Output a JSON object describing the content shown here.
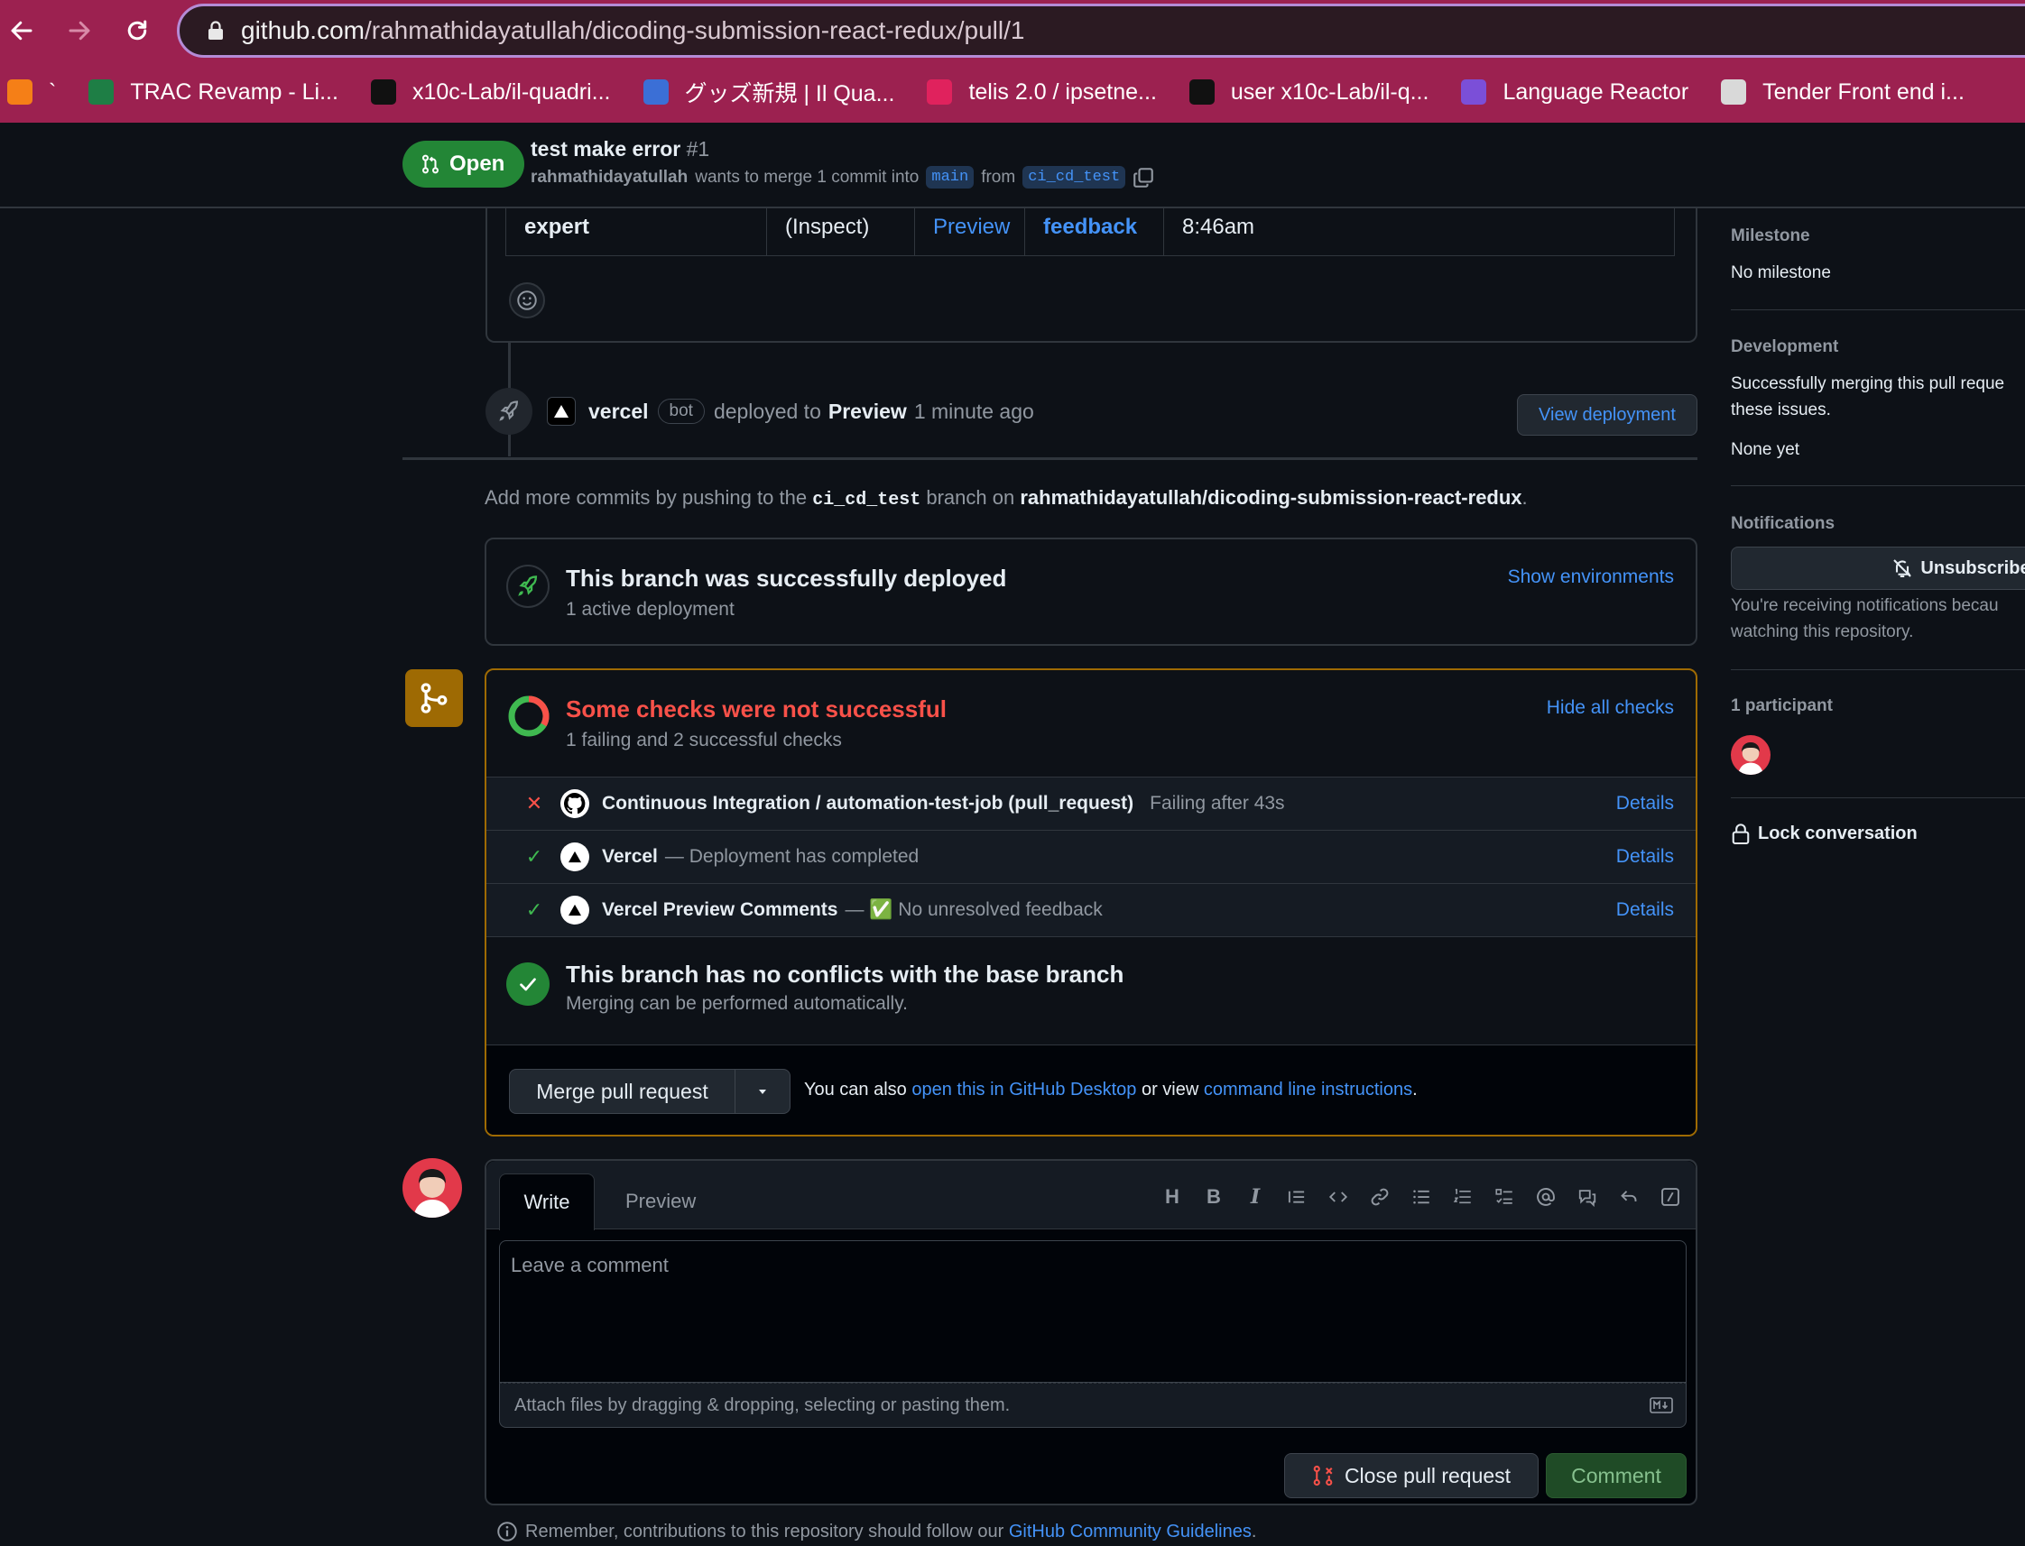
{
  "browser": {
    "url_host": "github.com",
    "url_path": "/rahmathidayatullah/dicoding-submission-react-redux/pull/1",
    "bookmarks": [
      {
        "label": "`",
        "color": "#f57f17",
        "icon": "xampp-icon"
      },
      {
        "label": "TRAC Revamp - Li...",
        "color": "#1e7e45",
        "icon": "excel-icon"
      },
      {
        "label": "x10c-Lab/il-quadri...",
        "color": "#111111",
        "icon": "github-icon"
      },
      {
        "label": "グッズ新規 | Il Qua...",
        "color": "#3b6fd6",
        "icon": "shield-icon"
      },
      {
        "label": "telis 2.0 / ipsetne...",
        "color": "#e0225d",
        "icon": "chevron-icon"
      },
      {
        "label": "user x10c-Lab/il-q...",
        "color": "#111111",
        "icon": "github-icon"
      },
      {
        "label": "Language Reactor",
        "color": "#7b4fd8",
        "icon": "lr-icon"
      },
      {
        "label": "Tender Front end i...",
        "color": "#d9d9d9",
        "icon": "trello-icon"
      }
    ]
  },
  "pr": {
    "state": "Open",
    "title": "test make error",
    "number": "#1",
    "author": "rahmathidayatullah",
    "merge_text": "wants to merge 1 commit into",
    "base": "main",
    "from_text": "from",
    "head": "ci_cd_test"
  },
  "deploy_table": {
    "cells": [
      "expert",
      "(Inspect)",
      "Preview",
      "feedback",
      "8:46am"
    ]
  },
  "deploy_event": {
    "actor": "vercel",
    "bot_label": "bot",
    "action": "deployed to",
    "target": "Preview",
    "time": "1 minute ago",
    "button": "View deployment"
  },
  "push_hint": {
    "prefix": "Add more commits by pushing to the",
    "branch": "ci_cd_test",
    "middle": "branch on",
    "repo": "rahmathidayatullah/dicoding-submission-react-redux",
    "suffix": "."
  },
  "deployments": {
    "title": "This branch was successfully deployed",
    "subtitle": "1 active deployment",
    "link": "Show environments"
  },
  "checks": {
    "title": "Some checks were not successful",
    "subtitle": "1 failing and 2 successful checks",
    "toggle": "Hide all checks",
    "items": [
      {
        "status": "fail",
        "name": "Continuous Integration / automation-test-job (pull_request)",
        "desc": "Failing after 43s",
        "link": "Details"
      },
      {
        "status": "success",
        "name": "Vercel",
        "desc": "— Deployment has completed",
        "link": "Details"
      },
      {
        "status": "success",
        "name": "Vercel Preview Comments",
        "desc": "— ✅ No unresolved feedback",
        "link": "Details"
      }
    ]
  },
  "conflicts": {
    "title": "This branch has no conflicts with the base branch",
    "subtitle": "Merging can be performed automatically."
  },
  "merge": {
    "button": "Merge pull request",
    "hint_prefix": "You can also",
    "desktop_link": "open this in GitHub Desktop",
    "hint_mid": "or view",
    "cli_link": "command line instructions",
    "hint_suffix": "."
  },
  "comment": {
    "tab_write": "Write",
    "tab_preview": "Preview",
    "placeholder": "Leave a comment",
    "attach": "Attach files by dragging & dropping, selecting or pasting them.",
    "close_button": "Close pull request",
    "comment_button": "Comment",
    "guidelines_prefix": "Remember, contributions to this repository should follow our",
    "guidelines_link": "GitHub Community Guidelines",
    "guidelines_suffix": "."
  },
  "sidebar": {
    "milestone_heading": "Milestone",
    "milestone_value": "No milestone",
    "development_heading": "Development",
    "development_text_1": "Successfully merging this pull reque",
    "development_text_2": "these issues.",
    "development_value": "None yet",
    "notifications_heading": "Notifications",
    "unsubscribe": "Unsubscribe",
    "notifications_text_1": "You're receiving notifications becau",
    "notifications_text_2": "watching this repository.",
    "participants_heading": "1 participant",
    "lock": "Lock conversation"
  }
}
